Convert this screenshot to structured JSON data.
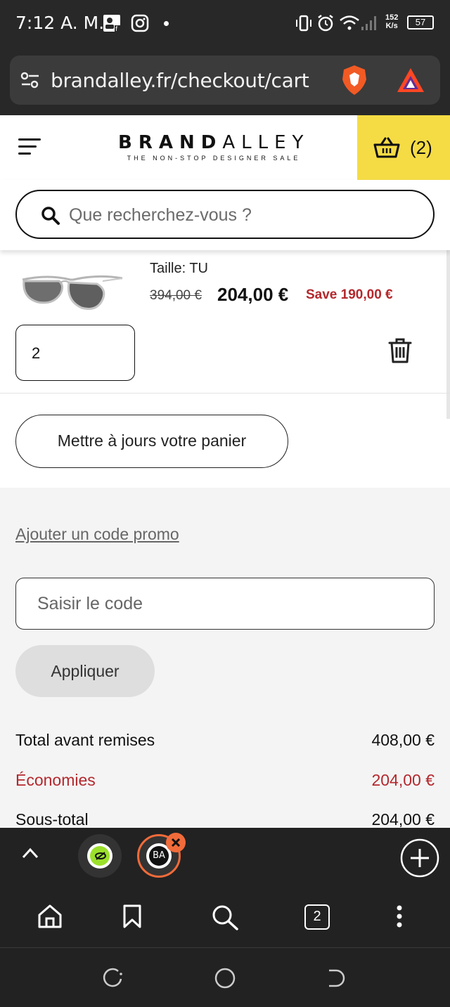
{
  "status_bar": {
    "time": "7:12 A. M.",
    "net_speed_value": "152",
    "net_speed_unit": "K/s",
    "battery": "57"
  },
  "browser": {
    "url": "brandalley.fr/checkout/cart",
    "open_tabs_count": "2"
  },
  "header": {
    "logo_bold": "BRAND",
    "logo_light": "ALLEY",
    "tagline": "THE NON-STOP DESIGNER SALE",
    "cart_count": "(2)"
  },
  "search": {
    "placeholder": "Que recherchez-vous ?"
  },
  "cart_item": {
    "size_label": "Taille: TU",
    "original_price": "394,00 €",
    "price": "204,00 €",
    "savings": "Save 190,00 €",
    "quantity": "2"
  },
  "update_cart_label": "Mettre à jours votre panier",
  "promo": {
    "link_label": "Ajouter un code promo",
    "input_placeholder": "Saisir le code",
    "apply_label": "Appliquer"
  },
  "summary": [
    {
      "label": "Total avant remises",
      "value": "408,00 €"
    },
    {
      "label": "Économies",
      "value": "204,00 €"
    },
    {
      "label": "Sous-total",
      "value": "204,00 €"
    }
  ],
  "colors": {
    "accent_yellow": "#f5dc45",
    "savings_red": "#b3282d",
    "tab_active_ring": "#f26b3a"
  }
}
